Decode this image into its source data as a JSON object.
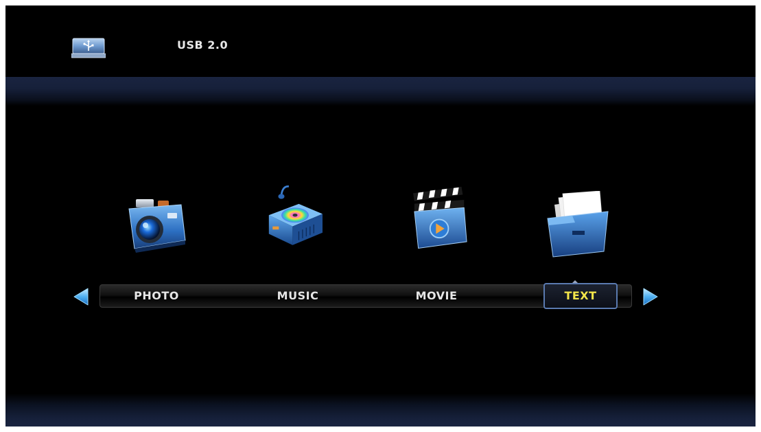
{
  "header": {
    "source_label": "USB 2.0",
    "source_icon": "usb-drive-icon"
  },
  "icons": [
    {
      "name": "photo-camera-icon"
    },
    {
      "name": "music-player-icon"
    },
    {
      "name": "movie-clapperboard-icon"
    },
    {
      "name": "text-folder-icon"
    }
  ],
  "menu": {
    "items": [
      {
        "label": "PHOTO"
      },
      {
        "label": "MUSIC"
      },
      {
        "label": "MOVIE"
      },
      {
        "label": "TEXT"
      }
    ],
    "selected": "TEXT",
    "left_arrow": "arrow-left-icon",
    "right_arrow": "arrow-right-icon"
  },
  "colors": {
    "background": "#000000",
    "label": "#e6e6e6",
    "selected_label": "#f5e64a",
    "selection_border": "#5a7ab0",
    "accent_blue": "#3d8ee0"
  }
}
